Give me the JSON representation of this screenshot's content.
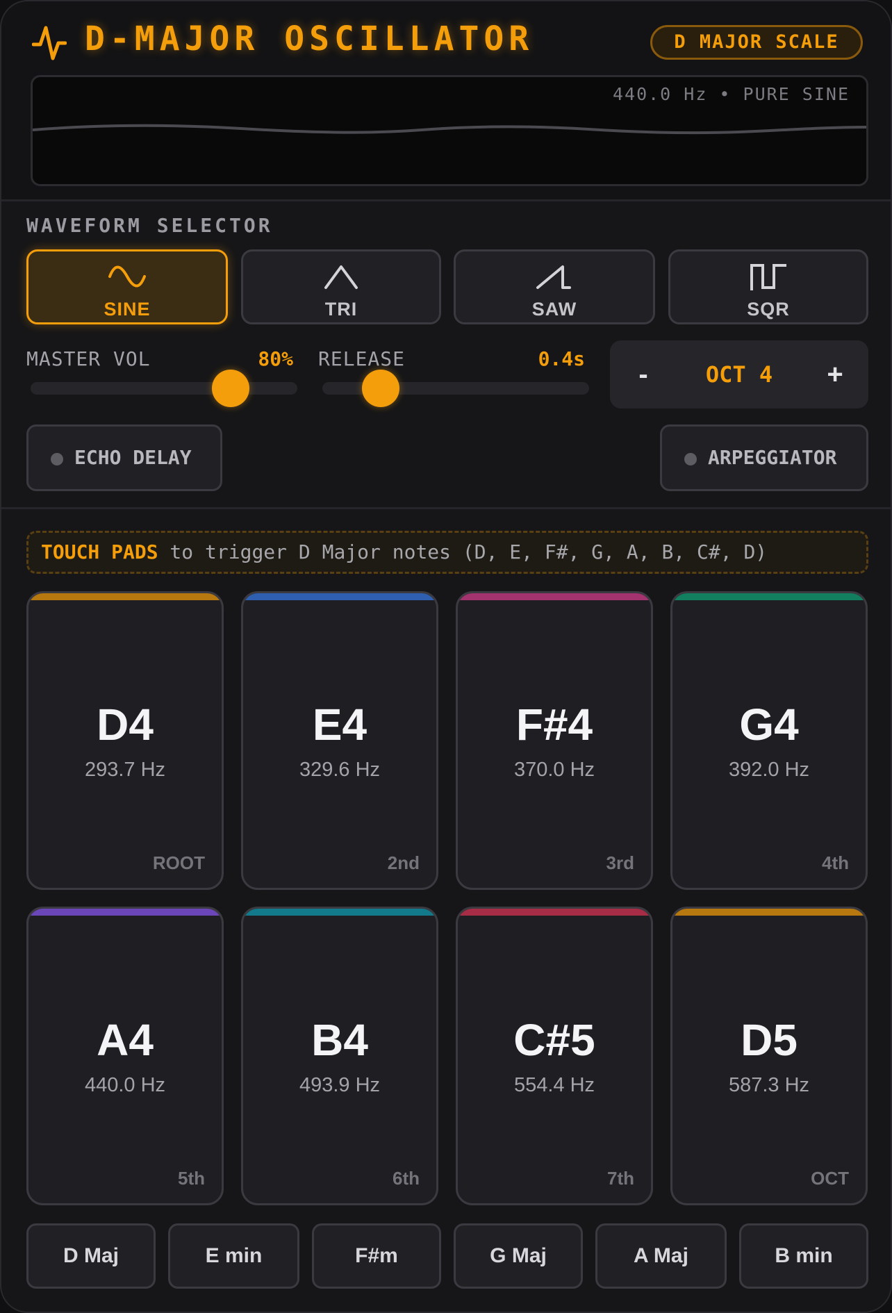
{
  "header": {
    "title": "D-MAJOR OSCILLATOR",
    "scale_badge": "D MAJOR SCALE",
    "scope_readout": "440.0 Hz • PURE SINE"
  },
  "waveform": {
    "section_label": "WAVEFORM SELECTOR",
    "selected": "SINE",
    "buttons": [
      {
        "label": "SINE",
        "icon": "sine-wave-icon"
      },
      {
        "label": "TRI",
        "icon": "triangle-wave-icon"
      },
      {
        "label": "SAW",
        "icon": "sawtooth-wave-icon"
      },
      {
        "label": "SQR",
        "icon": "square-wave-icon"
      }
    ]
  },
  "controls": {
    "master_vol": {
      "label": "MASTER VOL",
      "value": "80%",
      "level": 0.75
    },
    "release": {
      "label": "RELEASE",
      "value": "0.4s",
      "level": 0.22
    },
    "octave": {
      "decrement": "-",
      "label": "OCT 4",
      "increment": "+"
    }
  },
  "toggles": {
    "echo": {
      "label": "ECHO DELAY",
      "on": false
    },
    "arp": {
      "label": "ARPEGGIATOR",
      "on": false
    }
  },
  "hint": {
    "strong": "TOUCH PADS",
    "text": " to trigger D Major notes (D, E, F#, G, A, B, C#, D)"
  },
  "pads": [
    {
      "note": "D4",
      "freq": "293.7 Hz",
      "degree": "ROOT",
      "color": "#b7790f"
    },
    {
      "note": "E4",
      "freq": "329.6 Hz",
      "degree": "2nd",
      "color": "#2f5fb0"
    },
    {
      "note": "F#4",
      "freq": "370.0 Hz",
      "degree": "3rd",
      "color": "#a3336f"
    },
    {
      "note": "G4",
      "freq": "392.0 Hz",
      "degree": "4th",
      "color": "#12805e"
    },
    {
      "note": "A4",
      "freq": "440.0 Hz",
      "degree": "5th",
      "color": "#6b46b8"
    },
    {
      "note": "B4",
      "freq": "493.9 Hz",
      "degree": "6th",
      "color": "#137a8c"
    },
    {
      "note": "C#5",
      "freq": "554.4 Hz",
      "degree": "7th",
      "color": "#a62d45"
    },
    {
      "note": "D5",
      "freq": "587.3 Hz",
      "degree": "OCT",
      "color": "#b7790f"
    }
  ],
  "chords": [
    "D Maj",
    "E min",
    "F#m",
    "G Maj",
    "A Maj",
    "B min"
  ],
  "colors": {
    "accent": "#f59e0b",
    "background": "#161618",
    "surface": "#212125"
  }
}
